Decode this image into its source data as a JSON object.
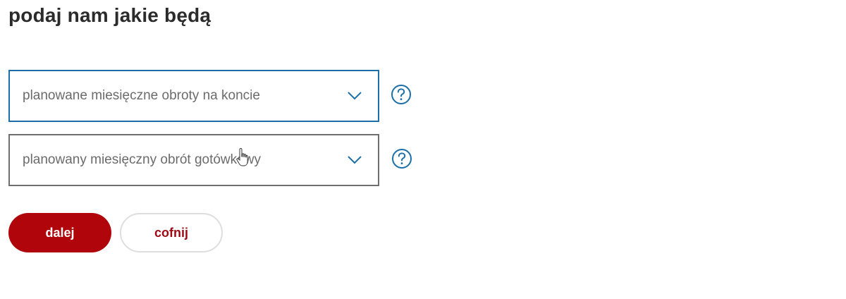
{
  "heading": "podaj nam jakie będą",
  "selects": [
    {
      "label": "planowane miesięczne obroty na koncie",
      "icon": "chevron-down-icon"
    },
    {
      "label": "planowany miesięczny obrót gotówkowy",
      "icon": "chevron-down-icon"
    }
  ],
  "help_icon": "question-circle-icon",
  "buttons": {
    "next_label": "dalej",
    "back_label": "cofnij"
  },
  "colors": {
    "accent_blue": "#1c6fa8",
    "primary_red": "#b0060b",
    "text_dark": "#2b2b2b",
    "text_muted": "#6b6b6b"
  }
}
